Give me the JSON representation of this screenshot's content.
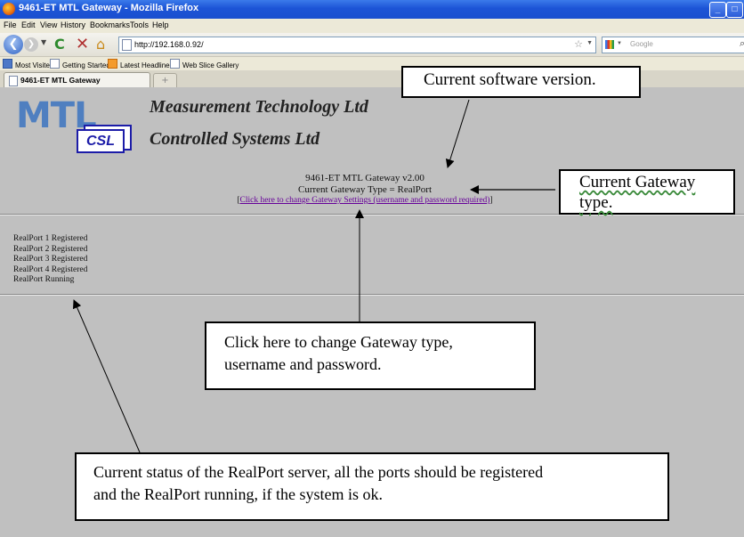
{
  "window": {
    "title": "9461-ET MTL Gateway - Mozilla Firefox",
    "controls": {
      "minimize": "_",
      "maximize": "□",
      "close": "×"
    }
  },
  "menu": [
    "File",
    "Edit",
    "View",
    "History",
    "Bookmarks",
    "Tools",
    "Help"
  ],
  "navbar": {
    "url": "http://192.168.0.92/",
    "search_placeholder": "Google"
  },
  "bookmarks": [
    "Most Visited",
    "Getting Started",
    "Latest Headlines",
    "Web Slice Gallery"
  ],
  "tabs": {
    "active": "9461-ET MTL Gateway",
    "new_tab": "+"
  },
  "page": {
    "mtl_logo": "MTL",
    "csl_logo": "CSL",
    "company1": "Measurement Technology Ltd",
    "company2": "Controlled Systems Ltd",
    "version": "9461-ET MTL Gateway v2.00",
    "gateway_type": "Current Gateway Type = RealPort",
    "settings_link": "Click here to change Gateway Settings (username and password required)",
    "status_lines": [
      "RealPort 1 Registered",
      "RealPort 2 Registered",
      "RealPort 3 Registered",
      "RealPort 4 Registered",
      "RealPort Running"
    ]
  },
  "callouts": {
    "version": "Current software version.",
    "gtype_line1": "Current Gateway",
    "gtype_line2": "type.",
    "click_line1": "Click here to change Gateway type,",
    "click_line2": "username and password.",
    "status_line1": "Current status of the RealPort server, all the ports should be registered",
    "status_line2": "and the RealPort running, if the system is ok."
  },
  "colors": {
    "page_bg": "#c0c0c0",
    "link": "#660099",
    "logo_blue": "#4f7fc0",
    "csl_blue": "#1c1ca8"
  }
}
